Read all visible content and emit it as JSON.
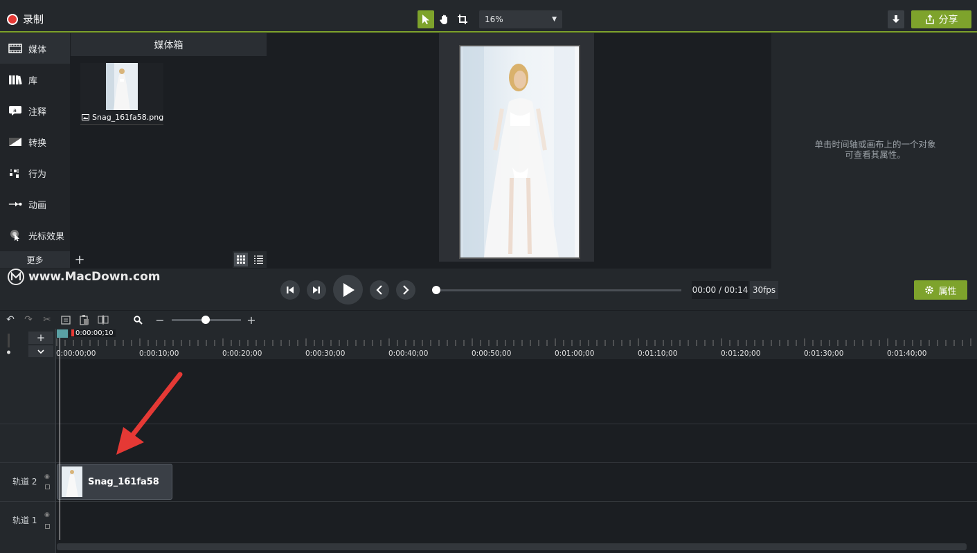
{
  "app": {
    "record_label": "录制",
    "zoom_value": "16%",
    "share_label": "分享"
  },
  "sidebar": {
    "items": [
      {
        "label": "媒体",
        "icon": "film-icon"
      },
      {
        "label": "库",
        "icon": "library-icon"
      },
      {
        "label": "注释",
        "icon": "annotation-icon"
      },
      {
        "label": "转换",
        "icon": "transition-icon"
      },
      {
        "label": "行为",
        "icon": "behavior-icon"
      },
      {
        "label": "动画",
        "icon": "animation-icon"
      },
      {
        "label": "光标效果",
        "icon": "cursor-effect-icon"
      }
    ],
    "more_label": "更多"
  },
  "media_bin": {
    "title": "媒体箱",
    "items": [
      {
        "name": "Snag_161fa58.png"
      }
    ]
  },
  "properties": {
    "hint_line1": "单击时间轴或画布上的一个对象",
    "hint_line2": "可查看其属性。",
    "button_label": "属性"
  },
  "watermark": {
    "text": "www.MacDown.com"
  },
  "playback": {
    "time": "00:00 / 00:14",
    "fps": "30fps",
    "progress": 0.01
  },
  "timeline": {
    "playhead_time": "0:00:00;10",
    "ticks": [
      "0:00:00;00",
      "0:00:10;00",
      "0:00:20;00",
      "0:00:30;00",
      "0:00:40;00",
      "0:00:50;00",
      "0:01:00;00",
      "0:01:10;00",
      "0:01:20;00",
      "0:01:30;00",
      "0:01:40;00"
    ],
    "tracks": [
      {
        "label": "轨道 2"
      },
      {
        "label": "轨道 1"
      }
    ],
    "clip_label": "Snag_161fa58"
  },
  "colors": {
    "accent": "#7ea32c",
    "record": "#e53935",
    "arrow": "#e53935"
  }
}
